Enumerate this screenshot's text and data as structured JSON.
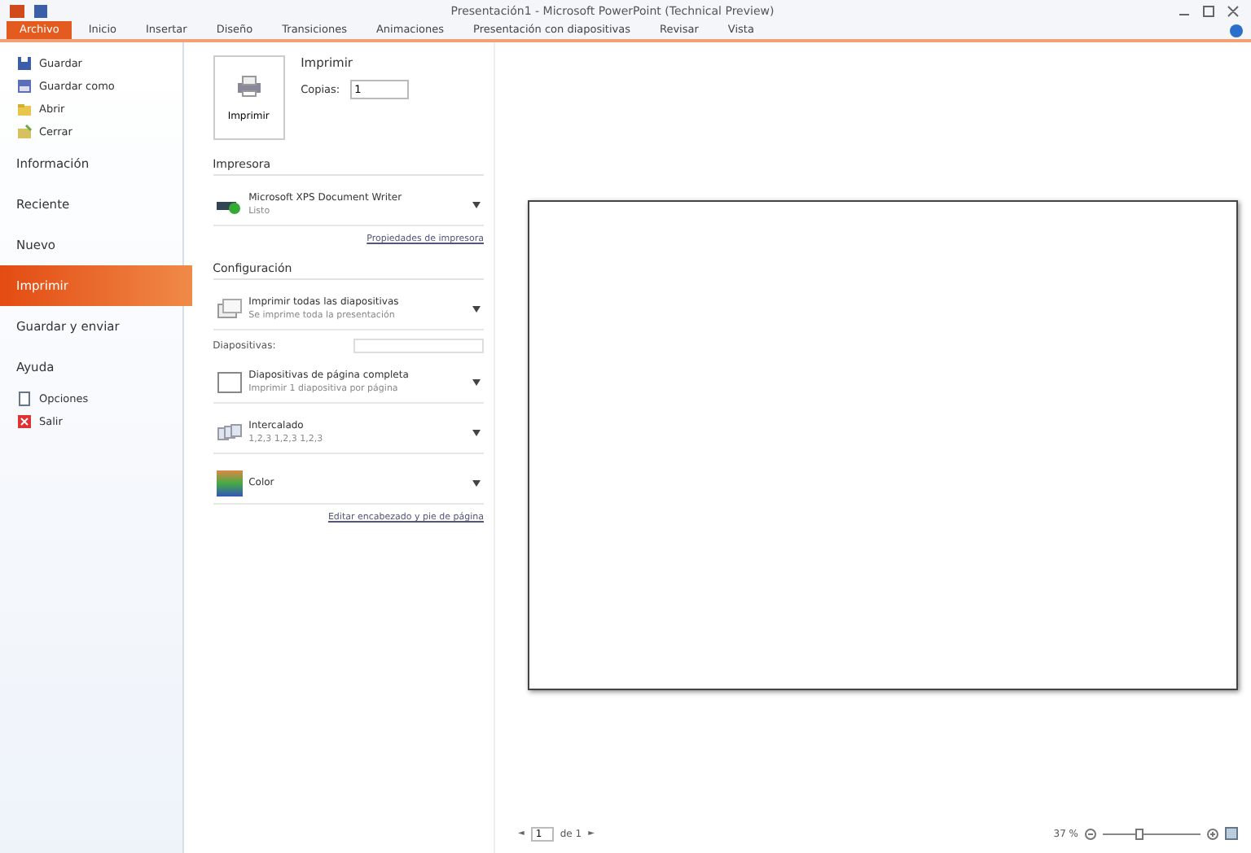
{
  "window": {
    "title": "Presentación1 - Microsoft PowerPoint (Technical Preview)"
  },
  "ribbon_tabs": [
    {
      "label": "Archivo",
      "selected": true
    },
    {
      "label": "Inicio",
      "selected": false
    },
    {
      "label": "Insertar",
      "selected": false
    },
    {
      "label": "Diseño",
      "selected": false
    },
    {
      "label": "Transiciones",
      "selected": false
    },
    {
      "label": "Animaciones",
      "selected": false
    },
    {
      "label": "Presentación con diapositivas",
      "selected": false
    },
    {
      "label": "Revisar",
      "selected": false
    },
    {
      "label": "Vista",
      "selected": false
    }
  ],
  "sidebar": {
    "items": [
      {
        "label": "Guardar",
        "kind": "command",
        "selected": false
      },
      {
        "label": "Guardar como",
        "kind": "command",
        "selected": false
      },
      {
        "label": "Abrir",
        "kind": "command",
        "selected": false
      },
      {
        "label": "Cerrar",
        "kind": "command",
        "selected": false
      },
      {
        "label": "Información",
        "kind": "page",
        "selected": false
      },
      {
        "label": "Reciente",
        "kind": "page",
        "selected": false
      },
      {
        "label": "Nuevo",
        "kind": "page",
        "selected": false
      },
      {
        "label": "Imprimir",
        "kind": "page",
        "selected": true
      },
      {
        "label": "Guardar y enviar",
        "kind": "page",
        "selected": false
      },
      {
        "label": "Ayuda",
        "kind": "page",
        "selected": false
      },
      {
        "label": "Opciones",
        "kind": "command",
        "selected": false
      },
      {
        "label": "Salir",
        "kind": "command",
        "selected": false
      }
    ]
  },
  "print": {
    "button": "Imprimir",
    "heading": "Imprimir",
    "copies_label": "Copias:",
    "copies_value": "1",
    "printer_heading": "Impresora",
    "printer": {
      "name": "Microsoft XPS Document Writer",
      "status": "Listo"
    },
    "printer_properties": "Propiedades de impresora",
    "settings_heading": "Configuración",
    "settings": [
      {
        "kind": "dropdown",
        "title": "Imprimir todas las diapositivas",
        "subtitle": "Se imprime toda la presentación"
      },
      {
        "kind": "field",
        "label": "Diapositivas:"
      },
      {
        "kind": "dropdown",
        "title": "Diapositivas de página completa",
        "subtitle": "Imprimir 1 diapositiva por página"
      },
      {
        "kind": "dropdown",
        "title": "Intercalado",
        "subtitle": "1,2,3   1,2,3   1,2,3"
      },
      {
        "kind": "dropdown",
        "title": "Color"
      }
    ],
    "footer_link": "Editar encabezado y pie de página"
  },
  "preview": {
    "page_nav": {
      "prev": "◄",
      "page": "1",
      "of": "de 1",
      "next": "►"
    },
    "zoom": {
      "reading": "37 %",
      "level": 0.37
    }
  }
}
